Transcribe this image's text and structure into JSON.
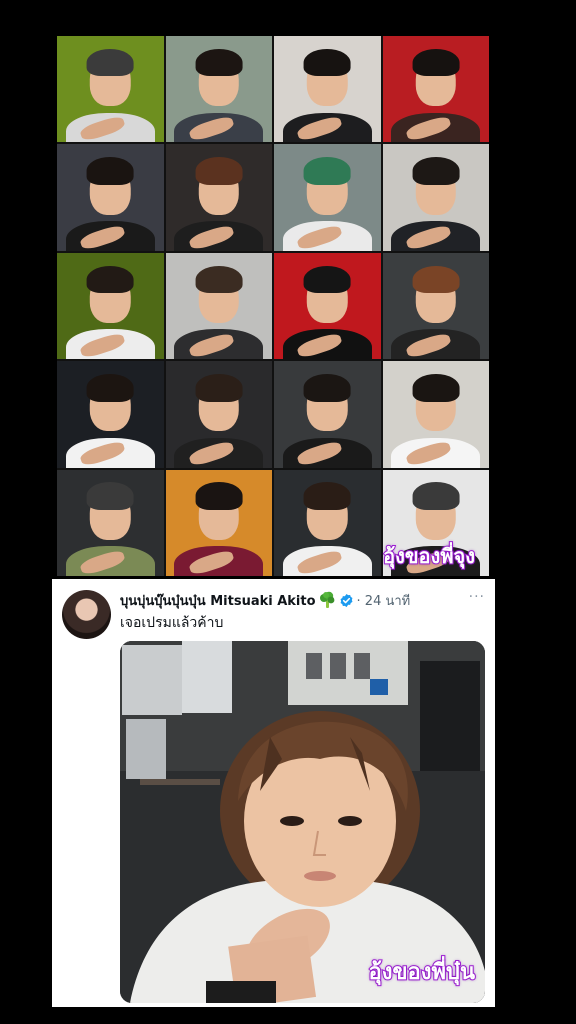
{
  "collage": {
    "caption": "อุ้งของพี่จุง",
    "tiles": [
      {
        "bg": "#6e8f1f",
        "shirt": "#d8d8d8",
        "hair": "#3b3b3b"
      },
      {
        "bg": "#8a9a8c",
        "shirt": "#3a3f48",
        "hair": "#1c1512"
      },
      {
        "bg": "#d7d3ce",
        "shirt": "#1d1d1f",
        "hair": "#171311"
      },
      {
        "bg": "#b91d22",
        "shirt": "#3a2420",
        "hair": "#161210"
      },
      {
        "bg": "#3a3c44",
        "shirt": "#1a1a1a",
        "hair": "#1a1411"
      },
      {
        "bg": "#2f2b2a",
        "shirt": "#1e1e1e",
        "hair": "#5b321f"
      },
      {
        "bg": "#7d8a88",
        "shirt": "#eaeaea",
        "hair": "#2f7a55"
      },
      {
        "bg": "#c9c7c2",
        "shirt": "#202226",
        "hair": "#1d1815"
      },
      {
        "bg": "#4f6a16",
        "shirt": "#ededed",
        "hair": "#221a15"
      },
      {
        "bg": "#bfbfbd",
        "shirt": "#2d2d2f",
        "hair": "#3b2c22"
      },
      {
        "bg": "#c0181e",
        "shirt": "#111111",
        "hair": "#151515"
      },
      {
        "bg": "#3b3e40",
        "shirt": "#232323",
        "hair": "#7a4426"
      },
      {
        "bg": "#1c1f24",
        "shirt": "#f2f2f2",
        "hair": "#1c1511"
      },
      {
        "bg": "#2a2a2c",
        "shirt": "#202020",
        "hair": "#2b1f18"
      },
      {
        "bg": "#383a3c",
        "shirt": "#1a1a1a",
        "hair": "#1b1613"
      },
      {
        "bg": "#d3d1cb",
        "shirt": "#f5f5f5",
        "hair": "#1a1512"
      },
      {
        "bg": "#2d2f31",
        "shirt": "#7b8a55",
        "hair": "#3a3a3a"
      },
      {
        "bg": "#d68a2a",
        "shirt": "#7a1a32",
        "hair": "#1a1412"
      },
      {
        "bg": "#2a2d30",
        "shirt": "#f0f0f0",
        "hair": "#2a1d16"
      },
      {
        "bg": "#e6e6e6",
        "shirt": "#1c1c1c",
        "hair": "#3a3a3a"
      }
    ]
  },
  "post": {
    "display_name": "บุนบุ่นบุ๊นบุ๋นบุ๋น Mitsuaki Akito",
    "emoji_icon": "broccoli-icon",
    "verified_icon": "verified-badge-icon",
    "time": "· 24 นาที",
    "more_label": "···",
    "text": "เจอเปรมแล้วค้าบ",
    "media_caption": "อุ้งของพี่บุ๋น",
    "colors": {
      "verified": "#1d9bf0",
      "caption_stroke": "#a523d9"
    }
  }
}
